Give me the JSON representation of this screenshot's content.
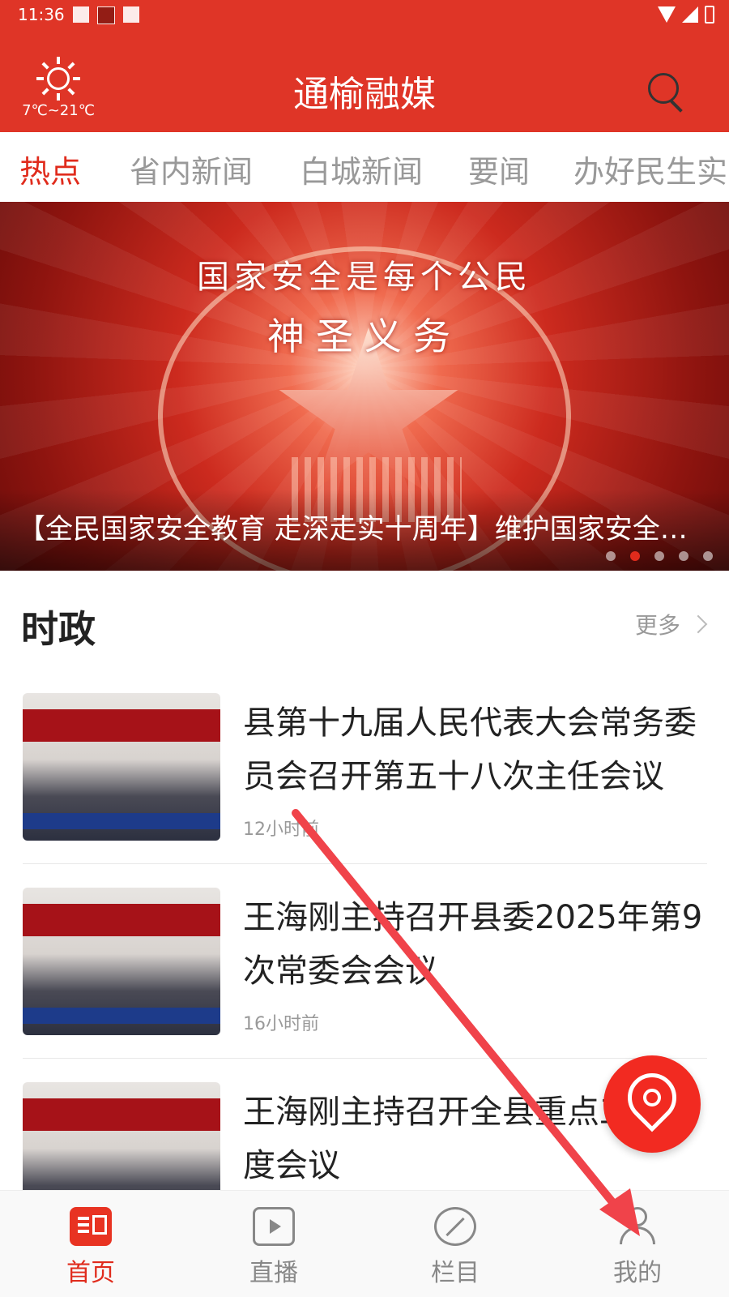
{
  "status_bar": {
    "time": "11:36"
  },
  "header": {
    "title": "通榆融媒",
    "temperature": "7℃~21℃",
    "weather_icon": "sun-icon",
    "search_icon": "search-icon"
  },
  "tabs": [
    {
      "label": "热点",
      "active": true
    },
    {
      "label": "省内新闻",
      "active": false
    },
    {
      "label": "白城新闻",
      "active": false
    },
    {
      "label": "要闻",
      "active": false
    },
    {
      "label": "办好民生实",
      "active": false
    }
  ],
  "banner": {
    "headline_line1": "国家安全是每个公民",
    "headline_line2": "神圣义务",
    "caption": "【全民国家安全教育 走深走实十周年】维护国家安全…",
    "dots_total": 5,
    "dot_active": 2
  },
  "section": {
    "title": "时政",
    "more_label": "更多"
  },
  "news": [
    {
      "title": "县第十九届人民代表大会常务委员会召开第五十八次主任会议",
      "time": "12小时前"
    },
    {
      "title": "王海刚主持召开县委2025年第9次常委会会议",
      "time": "16小时前"
    },
    {
      "title": "王海刚主持召开全县重点工作调度会议",
      "time": ""
    }
  ],
  "fab": {
    "icon": "location-pin-icon"
  },
  "bottom_nav": [
    {
      "label": "首页",
      "icon": "home-icon",
      "active": true
    },
    {
      "label": "直播",
      "icon": "live-icon",
      "active": false
    },
    {
      "label": "栏目",
      "icon": "column-icon",
      "active": false
    },
    {
      "label": "我的",
      "icon": "profile-icon",
      "active": false
    }
  ],
  "colors": {
    "brand_red": "#df3527",
    "active_red": "#e02b1c",
    "fab_red": "#f22a21",
    "annotation_arrow": "#f0434a"
  }
}
